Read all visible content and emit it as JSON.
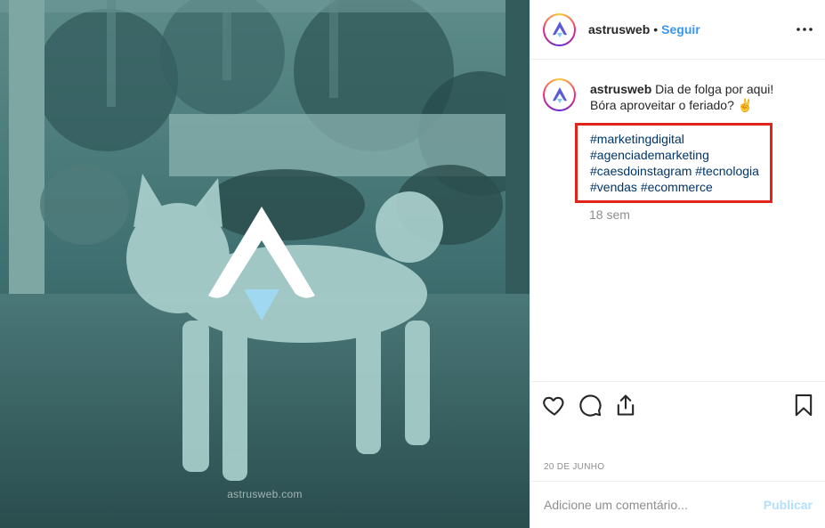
{
  "post": {
    "image_watermark": "astrusweb.com",
    "image_overlay_color": "#3c6a6b"
  },
  "header": {
    "username": "astrusweb",
    "separator": "•",
    "follow_label": "Seguir",
    "more_icon": "more-horizontal-icon"
  },
  "caption": {
    "username": "astrusweb",
    "text_line1": "Dia de folga por aqui!",
    "text_line2": "Bóra aproveitar o feriado? ✌️",
    "hashtags": [
      "#marketingdigital",
      "#agenciademarketing",
      "#caesdoinstagram",
      "#tecnologia",
      "#vendas",
      "#ecommerce"
    ],
    "time_ago": "18 sem"
  },
  "actions": {
    "like_icon": "heart-icon",
    "comment_icon": "comment-icon",
    "share_icon": "share-icon",
    "save_icon": "bookmark-icon"
  },
  "date": "20 DE JUNHO",
  "comment": {
    "placeholder": "Adicione um comentário...",
    "publish_label": "Publicar"
  },
  "colors": {
    "link_blue": "#3897f0",
    "hashtag": "#003569",
    "muted": "#8e8e8e",
    "highlight": "#e0241b",
    "publish_disabled": "#b2dffc"
  }
}
